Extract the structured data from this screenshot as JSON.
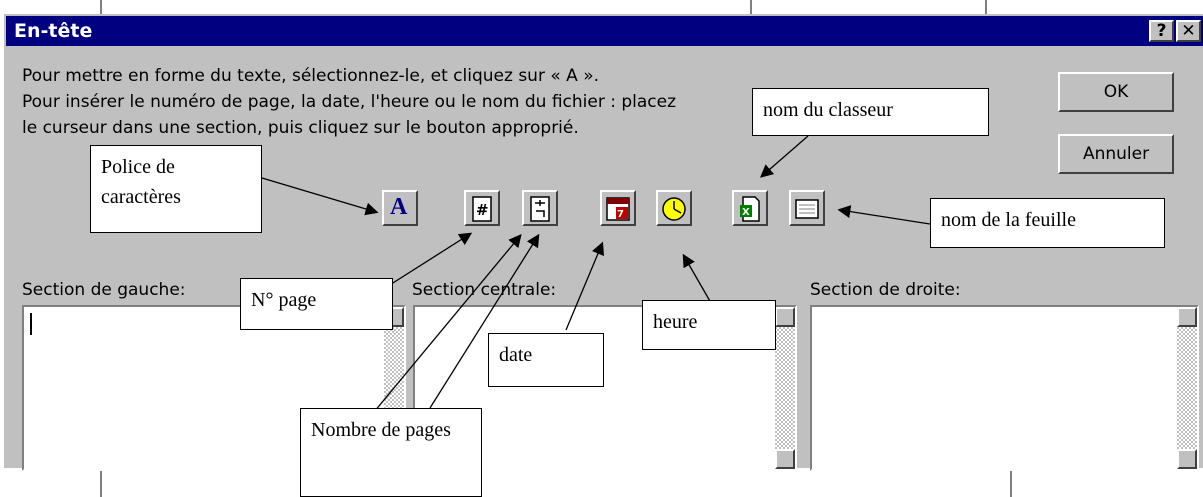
{
  "dialog": {
    "title": "En-tête",
    "help_label": "?",
    "close_label": "✕",
    "instructions": [
      "Pour mettre en forme du texte, sélectionnez-le, et cliquez sur « A ».",
      "Pour insérer le numéro de page, la date, l'heure ou le nom du fichier : placez",
      "le curseur dans une section, puis cliquez sur le bouton approprié."
    ],
    "ok_label": "OK",
    "cancel_label": "Annuler",
    "toolbar": [
      {
        "icon": "font-icon"
      },
      {
        "icon": "page-number-icon"
      },
      {
        "icon": "page-count-icon"
      },
      {
        "icon": "date-icon"
      },
      {
        "icon": "time-icon"
      },
      {
        "icon": "workbook-name-icon"
      },
      {
        "icon": "sheet-name-icon"
      }
    ],
    "sections": {
      "left": "Section de gauche:",
      "center": "Section centrale:",
      "right": "Section de droite:"
    },
    "section_values": {
      "left": "",
      "center": "",
      "right": ""
    }
  },
  "callouts": {
    "police": "Police de caractères",
    "classeur": "nom du classeur",
    "feuille": "nom de la feuille",
    "npage": "N° page",
    "heure": "heure",
    "date": "date",
    "nombre": "Nombre de pages"
  },
  "colors": {
    "titlebar": "#000080",
    "face": "#c0c0c0",
    "time_icon_fill": "#ffff00"
  }
}
